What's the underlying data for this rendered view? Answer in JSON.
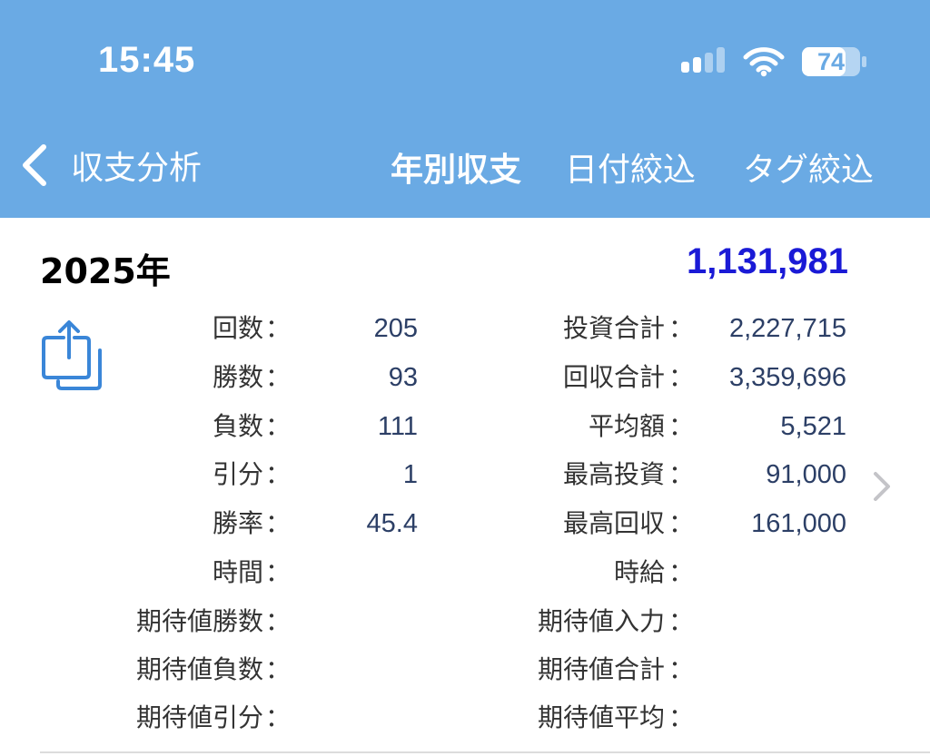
{
  "status_bar": {
    "time": "15:45",
    "battery": "74"
  },
  "nav": {
    "back_label": "収支分析",
    "title": "年別収支",
    "date_filter": "日付絞込",
    "tag_filter": "タグ絞込"
  },
  "summary": {
    "year": "2025年",
    "balance": "1,131,981"
  },
  "colon": "：",
  "left_stats": [
    {
      "label": "回数",
      "value": "205"
    },
    {
      "label": "勝数",
      "value": "93"
    },
    {
      "label": "負数",
      "value": "111"
    },
    {
      "label": "引分",
      "value": "1"
    },
    {
      "label": "勝率",
      "value": "45.4"
    },
    {
      "label": "時間",
      "value": ""
    },
    {
      "label": "期待値勝数",
      "value": ""
    },
    {
      "label": "期待値負数",
      "value": ""
    },
    {
      "label": "期待値引分",
      "value": ""
    }
  ],
  "right_stats": [
    {
      "label": "投資合計",
      "value": "2,227,715"
    },
    {
      "label": "回収合計",
      "value": "3,359,696"
    },
    {
      "label": "平均額",
      "value": "5,521"
    },
    {
      "label": "最高投資",
      "value": "91,000"
    },
    {
      "label": "最高回収",
      "value": "161,000"
    },
    {
      "label": "時給",
      "value": ""
    },
    {
      "label": "期待値入力",
      "value": ""
    },
    {
      "label": "期待値合計",
      "value": ""
    },
    {
      "label": "期待値平均",
      "value": ""
    }
  ],
  "colors": {
    "header_bg": "#6aaae4",
    "balance": "#1a1ad6",
    "value_text": "#2c3f66",
    "share_icon": "#3a86d8"
  },
  "icons": {
    "back": "chevron-left-icon",
    "share": "share-icon",
    "disclosure": "chevron-right-icon",
    "signal": "cellular-signal-icon",
    "wifi": "wifi-icon",
    "battery": "battery-icon"
  }
}
